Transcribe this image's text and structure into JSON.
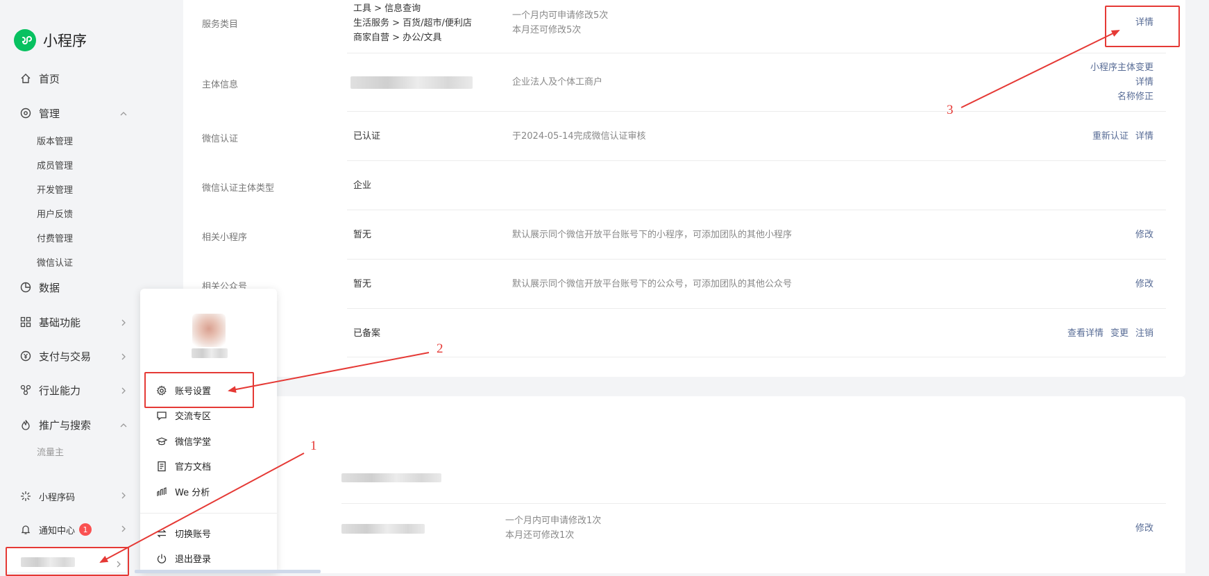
{
  "brand": {
    "name": "小程序",
    "logo_color": "#07c160"
  },
  "sidebar": {
    "home": "首页",
    "manage": "管理",
    "manage_items": [
      "版本管理",
      "成员管理",
      "开发管理",
      "用户反馈",
      "付费管理",
      "微信认证"
    ],
    "data": "数据",
    "basic": "基础功能",
    "pay": "支付与交易",
    "industry": "行业能力",
    "promo": "推广与搜索",
    "promo_items": [
      "流量主"
    ],
    "qrcode": "小程序码",
    "notify": "通知中心",
    "notify_count": "1"
  },
  "rows": {
    "service": {
      "label": "服务类目",
      "values": [
        "工具 > 信息查询",
        "生活服务 > 百货/超市/便利店",
        "商家自营 > 办公/文具"
      ],
      "desc": [
        "一个月内可申请修改5次",
        "本月还可修改5次"
      ],
      "action": "详情"
    },
    "subject": {
      "label": "主体信息",
      "desc": "企业法人及个体工商户",
      "actions": [
        "小程序主体变更",
        "详情",
        "名称修正"
      ]
    },
    "wxcert": {
      "label": "微信认证",
      "value": "已认证",
      "desc": "于2024-05-14完成微信认证审核",
      "actions": [
        "重新认证",
        "详情"
      ]
    },
    "certtype": {
      "label": "微信认证主体类型",
      "value": "企业"
    },
    "related_mp": {
      "label": "相关小程序",
      "value": "暂无",
      "desc": "默认展示同个微信开放平台账号下的小程序，可添加团队的其他小程序",
      "action": "修改"
    },
    "related_oa": {
      "label": "相关公众号",
      "value": "暂无",
      "desc": "默认展示同个微信开放平台账号下的公众号，可添加团队的其他公众号",
      "action": "修改"
    },
    "icp": {
      "value": "已备案",
      "actions": [
        "查看详情",
        "变更",
        "注销"
      ]
    }
  },
  "card2": {
    "row": {
      "desc": [
        "一个月内可申请修改1次",
        "本月还可修改1次"
      ],
      "action": "修改"
    }
  },
  "popup": {
    "items": [
      "账号设置",
      "交流专区",
      "微信学堂",
      "官方文档",
      "We 分析",
      "切换账号",
      "退出登录"
    ]
  },
  "annotations": {
    "n1": "1",
    "n2": "2",
    "n3": "3",
    "color": "#e53935"
  }
}
